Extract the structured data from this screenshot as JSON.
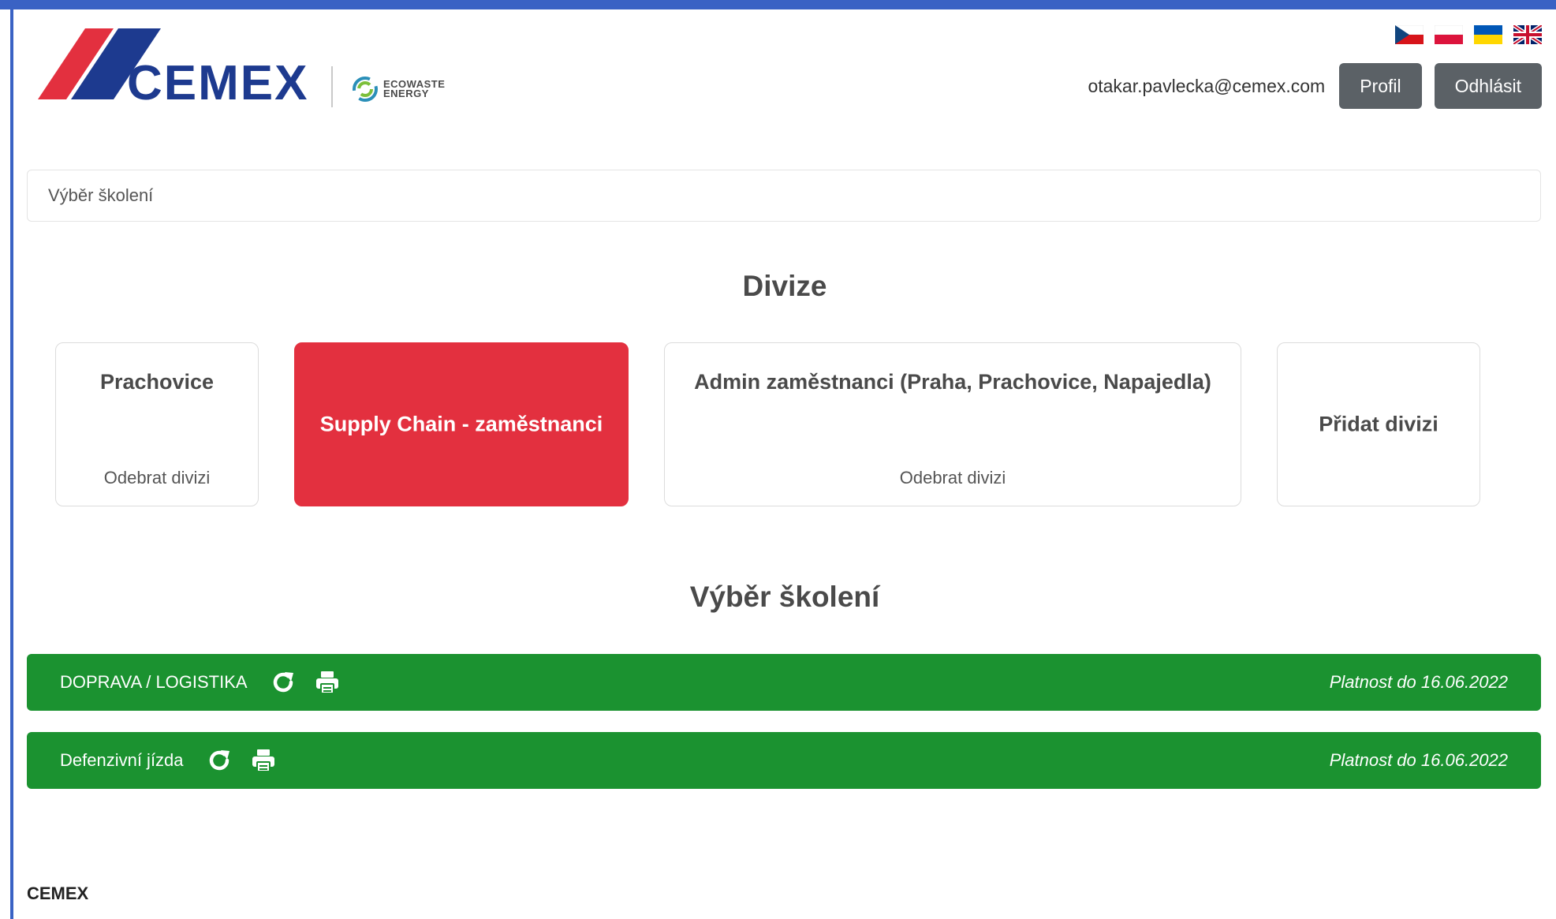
{
  "header": {
    "logo_text": "CEMEX",
    "eco_logo_line1": "ECOWASTE",
    "eco_logo_line2": "ENERGY",
    "languages": [
      "cz-flag",
      "pl-flag",
      "ua-flag",
      "uk-flag"
    ],
    "user_email": "otakar.pavlecka@cemex.com",
    "profile_label": "Profil",
    "logout_label": "Odhlásit"
  },
  "breadcrumb": {
    "label": "Výběr školení"
  },
  "divisions": {
    "title": "Divize",
    "items": [
      {
        "name": "Prachovice",
        "action": "Odebrat divizi"
      },
      {
        "name": "Supply Chain - zaměstnanci",
        "action": ""
      },
      {
        "name": "Admin zaměstnanci (Praha, Prachovice, Napajedla)",
        "action": "Odebrat divizi"
      },
      {
        "name": "Přidat divizi",
        "action": ""
      }
    ]
  },
  "trainings": {
    "title": "Výběr školení",
    "items": [
      {
        "name": "DOPRAVA / LOGISTIKA",
        "validity": "Platnost do 16.06.2022",
        "icons": [
          "refresh-icon",
          "print-icon"
        ]
      },
      {
        "name": "Defenzivní jízda",
        "validity": "Platnost do 16.06.2022",
        "icons": [
          "refresh-icon",
          "print-icon"
        ]
      }
    ]
  },
  "footer": {
    "text": "CEMEX"
  },
  "colors": {
    "brand_red": "#e3303f",
    "brand_blue": "#1d3a8f",
    "training_green": "#1b9230",
    "button_gray": "#5b6166",
    "frame_blue": "#3a62c4"
  }
}
